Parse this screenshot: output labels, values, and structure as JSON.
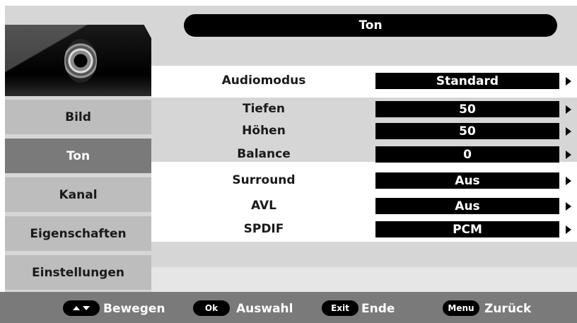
{
  "header": {
    "title": "Ton"
  },
  "sidebar": {
    "logo_icon": "speaker-icon",
    "items": [
      {
        "label": "Bild",
        "active": false
      },
      {
        "label": "Ton",
        "active": true
      },
      {
        "label": "Kanal",
        "active": false
      },
      {
        "label": "Eigenschaften",
        "active": false
      },
      {
        "label": "Einstellungen",
        "active": false
      }
    ]
  },
  "menu": {
    "rows": [
      {
        "label": "Audiomodus",
        "value": "Standard"
      },
      {
        "label": "Tiefen",
        "value": "50"
      },
      {
        "label": "Höhen",
        "value": "50"
      },
      {
        "label": "Balance",
        "value": "0"
      },
      {
        "label": "Surround",
        "value": "Aus"
      },
      {
        "label": "AVL",
        "value": "Aus"
      },
      {
        "label": "SPDIF",
        "value": "PCM"
      }
    ],
    "arrow_icon": "arrow-right-icon"
  },
  "footer": {
    "move": {
      "key_icon": "up-down-arrows-icon",
      "label": "Bewegen"
    },
    "ok": {
      "key": "Ok",
      "label": "Auswahl"
    },
    "exit": {
      "key": "Exit",
      "label": "Ende"
    },
    "menu": {
      "key": "Menu",
      "label": "Zurück"
    }
  },
  "colors": {
    "panel_light": "#d6d6d6",
    "panel_mid": "#bdbdbd",
    "active_gray": "#7a7a7a",
    "value_black": "#000000"
  }
}
